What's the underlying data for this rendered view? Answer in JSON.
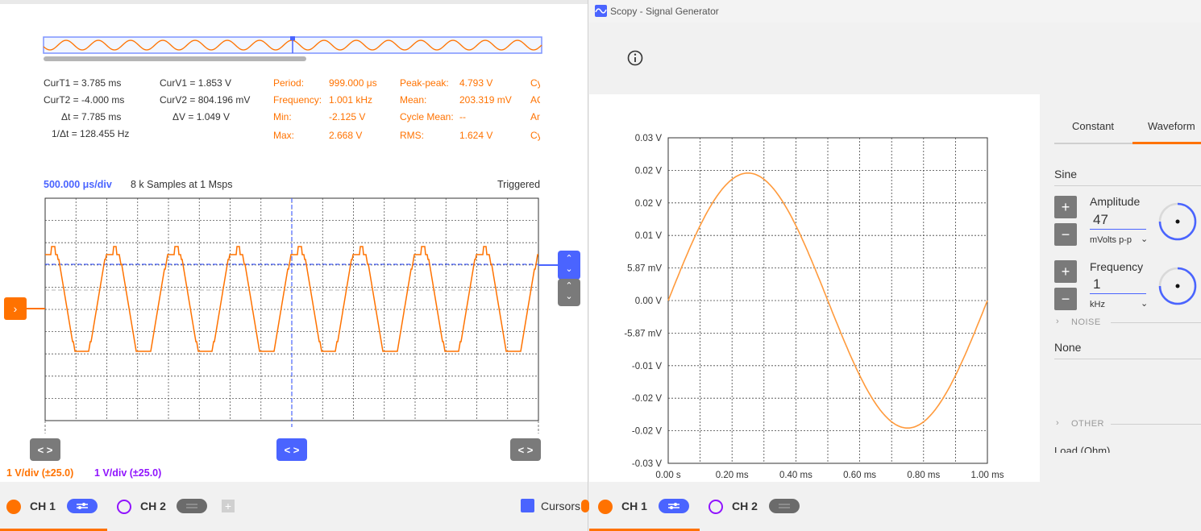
{
  "osc": {
    "measurements": {
      "cursors": [
        {
          "label": "CurT1 = 3.785 ms"
        },
        {
          "label": "CurT2 = -4.000 ms"
        },
        {
          "label": "Δt = 7.785 ms"
        },
        {
          "label": "1/Δt = 128.455 Hz"
        }
      ],
      "cursorsV": [
        {
          "label": "CurV1 = 1.853 V"
        },
        {
          "label": "CurV2 = 804.196 mV"
        },
        {
          "label": "ΔV = 1.049 V"
        }
      ],
      "stats1": [
        {
          "name": "Period:",
          "value": "999.000 μs"
        },
        {
          "name": "Frequency:",
          "value": "1.001 kHz"
        },
        {
          "name": "Min:",
          "value": "-2.125 V"
        },
        {
          "name": "Max:",
          "value": "2.668 V"
        }
      ],
      "stats2": [
        {
          "name": "Peak-peak:",
          "value": "4.793 V"
        },
        {
          "name": "Mean:",
          "value": "203.319 mV"
        },
        {
          "name": "Cycle Mean:",
          "value": "--"
        },
        {
          "name": "RMS:",
          "value": "1.624 V"
        }
      ],
      "stats3": [
        "Cy",
        "AC",
        "An",
        "Cy"
      ]
    },
    "timebase": "500.000 μs/div",
    "samples": "8 k Samples at 1 Msps",
    "status": "Triggered",
    "ch1_scale": "1 V/div (±25.0)",
    "ch2_scale": "1 V/div (±25.0)",
    "ch1_label": "CH 1",
    "ch2_label": "CH 2",
    "cursors_label": "Cursors"
  },
  "sg": {
    "title": "Scopy - Signal Generator",
    "tabs": [
      "Constant",
      "Waveform"
    ],
    "waveform": "Sine",
    "amplitude": {
      "label": "Amplitude",
      "value": "47",
      "unit": "mVolts p-p"
    },
    "frequency": {
      "label": "Frequency",
      "value": "1",
      "unit": "kHz"
    },
    "noise_section": "NOISE",
    "noise_value": "None",
    "other_section": "OTHER",
    "load_label": "Load (Ohm)",
    "ch1_label": "CH 1",
    "ch2_label": "CH 2",
    "y_ticks": [
      "0.03 V",
      "0.02 V",
      "0.02 V",
      "0.01 V",
      "5.87 mV",
      "0.00 V",
      "-5.87 mV",
      "-0.01 V",
      "-0.02 V",
      "-0.02 V",
      "-0.03 V"
    ],
    "x_ticks": [
      "0.00 s",
      "0.20 ms",
      "0.40 ms",
      "0.60 ms",
      "0.80 ms",
      "1.00 ms"
    ]
  },
  "colors": {
    "ch1": "#ff7200",
    "ch2": "#9013fe",
    "accent": "#4a64ff",
    "grid": "#555555"
  }
}
